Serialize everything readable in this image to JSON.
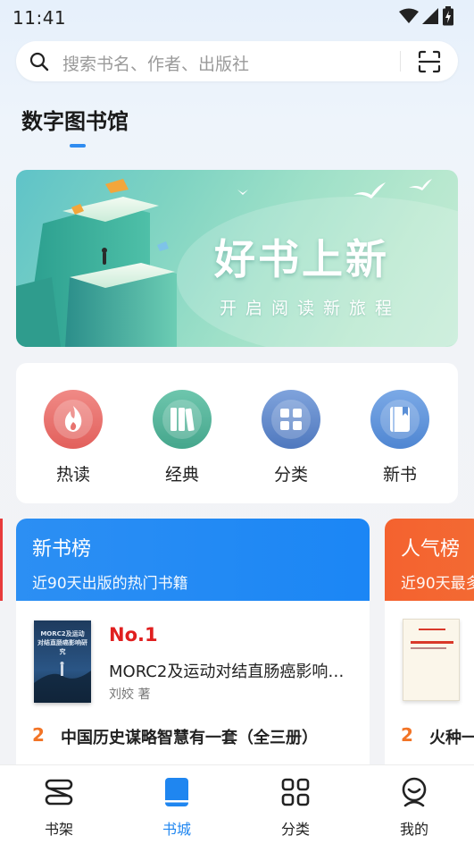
{
  "status_bar": {
    "time": "11:41"
  },
  "search": {
    "placeholder": "搜索书名、作者、出版社"
  },
  "page": {
    "title": "数字图书馆"
  },
  "banner": {
    "title": "好书上新",
    "subtitle": "开启阅读新旅程"
  },
  "quick_menu": {
    "items": [
      {
        "label": "热读",
        "icon": "fire-icon",
        "color": "#e8736f"
      },
      {
        "label": "经典",
        "icon": "books-icon",
        "color": "#56b29a"
      },
      {
        "label": "分类",
        "icon": "grid-icon",
        "color": "#5d86c8"
      },
      {
        "label": "新书",
        "icon": "book-icon",
        "color": "#5a8fd6"
      }
    ]
  },
  "rankings": [
    {
      "title": "新书榜",
      "subtitle": "近90天出版的热门书籍",
      "color": "#1f88f4",
      "top": {
        "rank": "No.1",
        "title": "MORC2及运动对结直肠癌影响研究",
        "author": "刘姣 著",
        "cover_text": "MORC2及运动对结直肠癌影响研究"
      },
      "second": {
        "rank": "2",
        "title": "中国历史谋略智慧有一套（全三册）"
      }
    },
    {
      "title": "人气榜",
      "subtitle": "近90天最多",
      "color": "#f4622f",
      "second": {
        "rank": "2",
        "title": "火种一"
      }
    }
  ],
  "bottom_nav": {
    "items": [
      {
        "label": "书架",
        "icon": "bookshelf-icon",
        "active": false
      },
      {
        "label": "书城",
        "icon": "bookstore-icon",
        "active": true
      },
      {
        "label": "分类",
        "icon": "category-icon",
        "active": false
      },
      {
        "label": "我的",
        "icon": "profile-icon",
        "active": false
      }
    ]
  }
}
